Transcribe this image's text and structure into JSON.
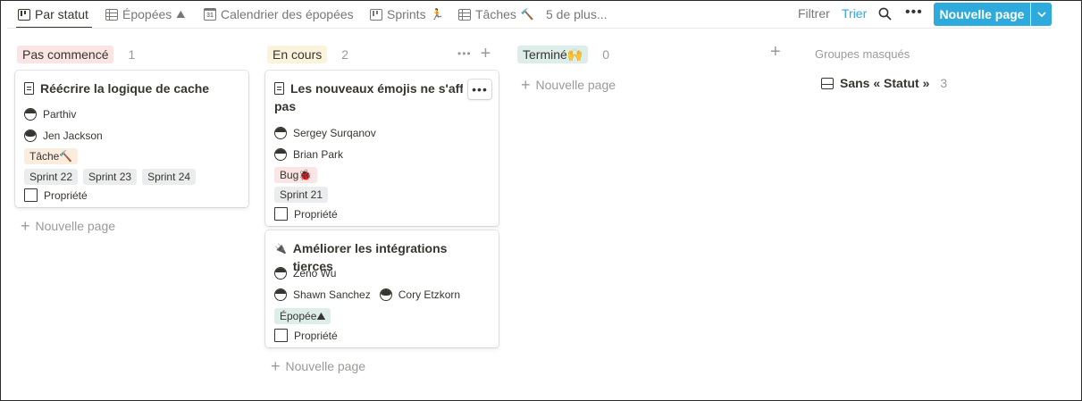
{
  "views": {
    "tabs": [
      {
        "label": "Par statut",
        "icon": "board-icon",
        "emoji": ""
      },
      {
        "label": "Épopées",
        "icon": "table-icon",
        "emoji": "⛰"
      },
      {
        "label": "Calendrier des épopées",
        "icon": "calendar-icon",
        "emoji": "",
        "icon_text": "31"
      },
      {
        "label": "Sprints",
        "icon": "board-icon",
        "emoji": "🏃"
      },
      {
        "label": "Tâches",
        "icon": "table-icon",
        "emoji": "🔨"
      },
      {
        "label": "5 de plus...",
        "icon": "",
        "emoji": ""
      }
    ],
    "active_index": 0
  },
  "toolbar": {
    "filter_label": "Filtrer",
    "sort_label": "Trier",
    "new_page_label": "Nouvelle page",
    "accent_color": "#2eaadc"
  },
  "columns": [
    {
      "status": "Pas commencé",
      "count": "1",
      "pill_bg": "#fbe4e4",
      "new_page_label": "Nouvelle page",
      "cards": [
        {
          "title": "Réécrire la logique de cache",
          "assignees": [
            [
              "Parthiv"
            ],
            [
              "Jen Jackson"
            ]
          ],
          "tags": [
            [
              "Tâche🔨"
            ],
            [
              "Sprint 22",
              "Sprint 23",
              "Sprint 24"
            ]
          ],
          "property_label": "Propriété"
        }
      ]
    },
    {
      "status": "En cours",
      "count": "2",
      "pill_bg": "#fbf3db",
      "new_page_label": "Nouvelle page",
      "cards": [
        {
          "title_line1": "Les nouveaux émojis ne s'affich",
          "title_line2": "pas",
          "assignees": [
            [
              "Sergey Surqanov"
            ],
            [
              "Brian Park"
            ]
          ],
          "tags": [
            [
              "Bug🐞"
            ],
            [
              "Sprint 21"
            ]
          ],
          "property_label": "Propriété"
        },
        {
          "title": "Améliorer les intégrations tierces",
          "icon_emoji": "🔌",
          "assignees": [
            [
              "Zeno Wu"
            ],
            [
              "Shawn Sanchez",
              "Cory Etzkorn"
            ]
          ],
          "tags": [
            [
              "Épopée⛰"
            ]
          ],
          "property_label": "Propriété"
        }
      ]
    },
    {
      "status": "Terminé🙌",
      "count": "0",
      "pill_bg": "#ddedea",
      "new_page_label": "Nouvelle page",
      "cards": []
    }
  ],
  "hidden_groups": {
    "title": "Groupes masqués",
    "items": [
      {
        "label": "Sans « Statut »",
        "count": "3"
      }
    ]
  }
}
